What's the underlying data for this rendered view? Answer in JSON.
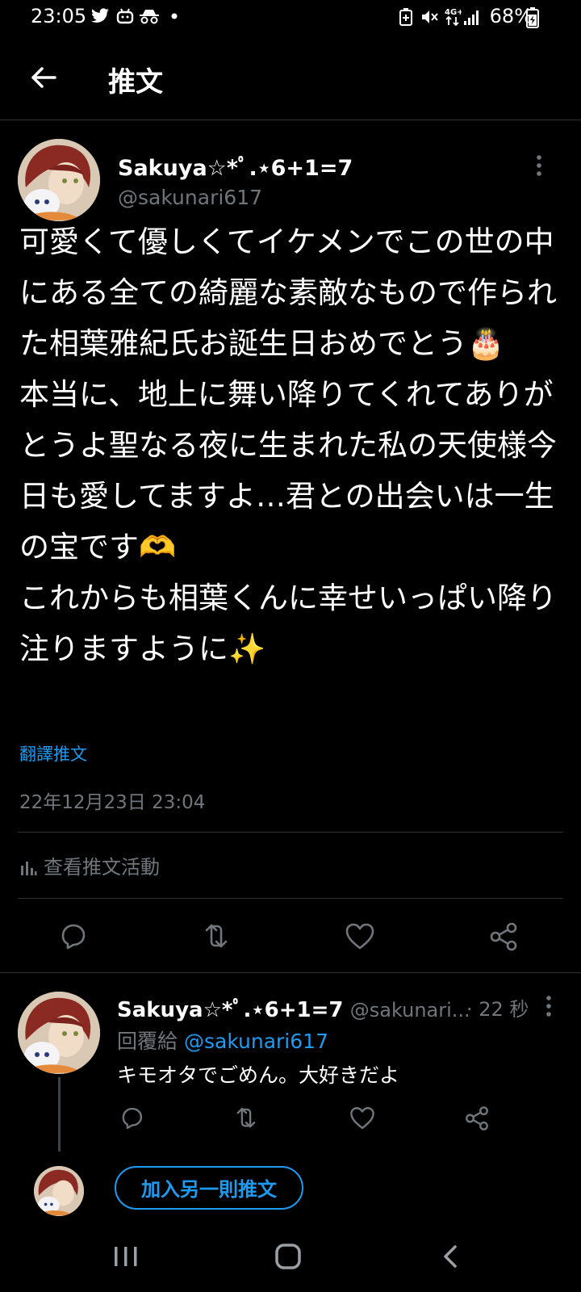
{
  "status_bar": {
    "time": "23:05",
    "battery": "68%",
    "icons": [
      "twitter-icon",
      "app-icon",
      "incognito-icon",
      "dot-icon",
      "battery-saver-icon",
      "mute-icon",
      "4g-icon",
      "signal-icon",
      "battery-icon"
    ]
  },
  "header": {
    "title": "推文"
  },
  "tweet": {
    "author_name": "Sakuya☆*ﾟ.⋆6+1=7",
    "author_handle": "@sakunari617",
    "body": "可愛くて優しくてイケメンでこの世の中にある全ての綺麗な素敵なもので作られた相葉雅紀氏お誕生日おめでとう🎂\n本当に、地上に舞い降りてくれてありがとうよ聖なる夜に生まれた私の天使様今日も愛してますよ…君との出会いは一生の宝です🫶\nこれからも相葉くんに幸せいっぱい降り注りますように✨",
    "translate_label": "翻譯推文",
    "datetime": "22年12月23日 23:04",
    "activity_label": "查看推文活動"
  },
  "reply": {
    "author_name": "Sakuya☆*ﾟ.⋆6+1=7",
    "author_handle": "@sakunari...",
    "time": "· 22 秒",
    "reply_to_prefix": "回覆給",
    "reply_to_handle": "@sakunari617",
    "text": "キモオタでごめん。大好きだよ"
  },
  "add_tweet_button": "加入另一則推文",
  "colors": {
    "accent": "#1d9bf0",
    "background": "#000000",
    "muted": "#71767b"
  }
}
